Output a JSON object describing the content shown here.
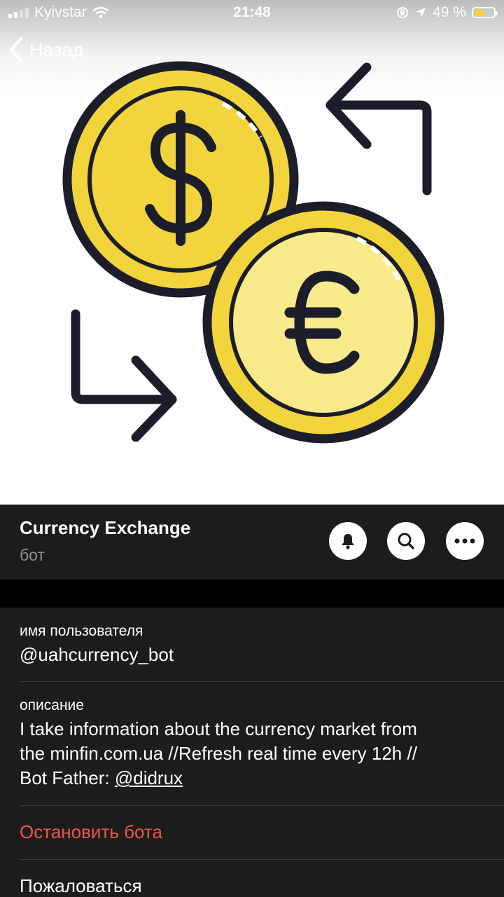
{
  "status_bar": {
    "carrier": "Kyivstar",
    "time": "21:48",
    "battery_percent": "49 %",
    "battery_level": 0.49,
    "battery_color": "#ffd21f"
  },
  "nav": {
    "back_label": "Назад",
    "back_icon": "chevron-left-icon"
  },
  "profile": {
    "image_icon": "currency-exchange-icon",
    "title": "Currency Exchange",
    "subtitle": "бот",
    "actions": [
      {
        "icon": "bell-icon"
      },
      {
        "icon": "search-icon"
      },
      {
        "icon": "more-icon"
      }
    ]
  },
  "info": {
    "username_label": "имя пользователя",
    "username_value": "@uahcurrency_bot",
    "description_label": "описание",
    "description_line1": "I take information about the currency market from",
    "description_line2": "the minfin.com.ua //Refresh real time every 12h //",
    "description_line3_prefix": "Bot Father: ",
    "description_link": "@didrux",
    "stop_bot_label": "Остановить бота",
    "report_label": "Пожаловаться"
  },
  "colors": {
    "background": "#1c1c1d",
    "danger": "#e8584b",
    "coin_gold": "#f2d43d",
    "coin_inner": "#f9ea8c",
    "outline": "#1b1d2a"
  }
}
